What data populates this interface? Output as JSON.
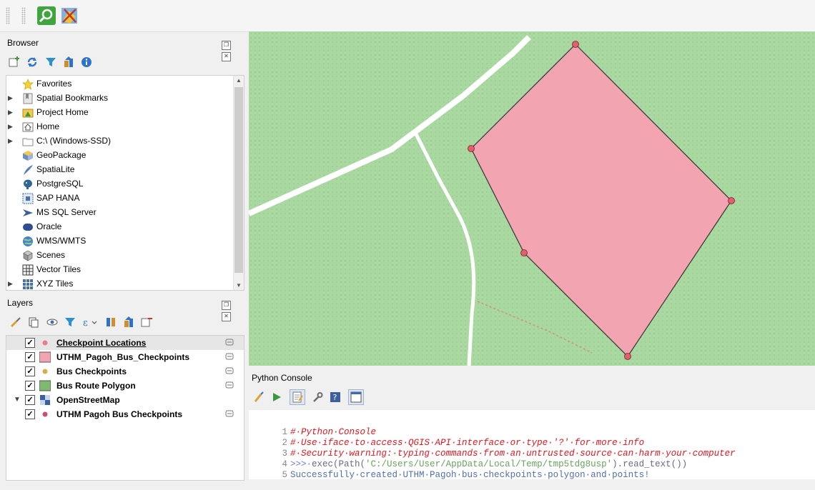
{
  "toolbar": {
    "icons": [
      "identify-icon",
      "digitize-icon"
    ]
  },
  "browser": {
    "title": "Browser",
    "items": [
      {
        "label": "Favorites",
        "icon": "star-icon",
        "expandable": false
      },
      {
        "label": "Spatial Bookmarks",
        "icon": "bookmark-icon",
        "expandable": true
      },
      {
        "label": "Project Home",
        "icon": "project-home-icon",
        "expandable": true
      },
      {
        "label": "Home",
        "icon": "home-folder-icon",
        "expandable": true
      },
      {
        "label": "C:\\ (Windows-SSD)",
        "icon": "drive-icon",
        "expandable": true
      },
      {
        "label": "GeoPackage",
        "icon": "geopackage-icon",
        "expandable": false
      },
      {
        "label": "SpatiaLite",
        "icon": "spatialite-icon",
        "expandable": false
      },
      {
        "label": "PostgreSQL",
        "icon": "postgresql-icon",
        "expandable": false
      },
      {
        "label": "SAP HANA",
        "icon": "sap-hana-icon",
        "expandable": false
      },
      {
        "label": "MS SQL Server",
        "icon": "mssql-icon",
        "expandable": false
      },
      {
        "label": "Oracle",
        "icon": "oracle-icon",
        "expandable": false
      },
      {
        "label": "WMS/WMTS",
        "icon": "wms-icon",
        "expandable": false
      },
      {
        "label": "Scenes",
        "icon": "scenes-icon",
        "expandable": false
      },
      {
        "label": "Vector Tiles",
        "icon": "vector-tiles-icon",
        "expandable": false
      },
      {
        "label": "XYZ Tiles",
        "icon": "xyz-tiles-icon",
        "expandable": true
      }
    ]
  },
  "layers": {
    "title": "Layers",
    "items": [
      {
        "label": "Checkpoint Locations",
        "symbol": "point-pink",
        "checked": true,
        "selected": true,
        "underline": true,
        "indent": 0
      },
      {
        "label": "UTHM_Pagoh_Bus_Checkpoints",
        "symbol": "polygon-pink",
        "checked": true,
        "selected": false,
        "underline": false,
        "indent": 0
      },
      {
        "label": "Bus Checkpoints",
        "symbol": "point-gold",
        "checked": true,
        "selected": false,
        "underline": false,
        "indent": 0
      },
      {
        "label": "Bus Route Polygon",
        "symbol": "polygon-green",
        "checked": true,
        "selected": false,
        "underline": false,
        "indent": 0
      },
      {
        "label": "OpenStreetMap",
        "symbol": "raster",
        "checked": true,
        "selected": false,
        "underline": false,
        "indent": 0,
        "expanded": true
      },
      {
        "label": "UTHM Pagoh Bus Checkpoints",
        "symbol": "point-pink",
        "checked": true,
        "selected": false,
        "underline": false,
        "indent": 0
      }
    ]
  },
  "console": {
    "title": "Python Console",
    "lines": [
      {
        "num": "1",
        "parts": [
          {
            "cls": "c-comment",
            "text": "#·Python·Console"
          }
        ]
      },
      {
        "num": "2",
        "parts": [
          {
            "cls": "c-comment",
            "text": "#·Use·iface·to·access·QGIS·API·interface·or·type·'?'·for·more·info"
          }
        ]
      },
      {
        "num": "3",
        "parts": [
          {
            "cls": "c-comment",
            "text": "#·Security·warning:·typing·commands·from·an·untrusted·source·can·harm·your·computer"
          }
        ]
      },
      {
        "num": "4",
        "parts": [
          {
            "cls": "c-prompt",
            "text": ">>>·"
          },
          {
            "cls": "c-plain",
            "text": "exec(Path("
          },
          {
            "cls": "c-str",
            "text": "'C:/Users/User/AppData/Local/Temp/tmp5tdg8usp'"
          },
          {
            "cls": "c-plain",
            "text": ").read_text())"
          }
        ]
      },
      {
        "num": "5",
        "parts": [
          {
            "cls": "c-out",
            "text": "Successfully·created·UTHM·Pagoh·bus·checkpoints·polygon·and·points!"
          }
        ]
      }
    ]
  },
  "map": {
    "background_color": "#a9d9a0",
    "polygon_fill": "#f2a5b0",
    "vertex_color": "#e0606f",
    "road_color": "#ffffff"
  }
}
